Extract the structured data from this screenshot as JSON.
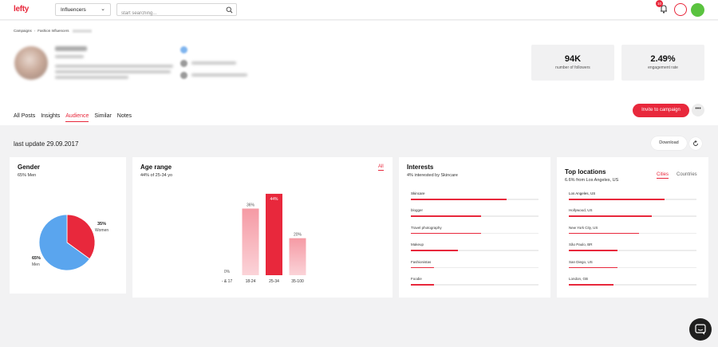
{
  "header": {
    "logo": "lefty",
    "category_select": "Influencers",
    "search_placeholder": "start searching...",
    "notification_count": "10"
  },
  "breadcrumb": [
    "Campaigns",
    "Fashion Influencers"
  ],
  "stats": [
    {
      "value": "94K",
      "label": "number of followers"
    },
    {
      "value": "2.49%",
      "label": "engagement rate"
    }
  ],
  "tabs": [
    "All Posts",
    "Insights",
    "Audience",
    "Similar",
    "Notes"
  ],
  "active_tab": "Audience",
  "invite_label": "Invite to campaign",
  "more_label": "•••",
  "last_update": "last update 29.09.2017",
  "download_label": "Download",
  "gender": {
    "title": "Gender",
    "subtitle": "65% Men",
    "women_pct": "35%",
    "women_label": "Women",
    "men_pct": "65%",
    "men_label": "Men"
  },
  "age": {
    "title": "Age range",
    "subtitle": "44% of 25-34 yo",
    "filter": "All"
  },
  "interests": {
    "title": "Interests",
    "subtitle": "4% interested by Skincare",
    "items": [
      {
        "label": "Skincare",
        "value": 0.75
      },
      {
        "label": "blogger",
        "value": 0.55
      },
      {
        "label": "Travel photography",
        "value": 0.55
      },
      {
        "label": "Makeup",
        "value": 0.37
      },
      {
        "label": "Fashionistas",
        "value": 0.18
      },
      {
        "label": "Foodie",
        "value": 0.18
      }
    ]
  },
  "locations": {
    "title": "Top locations",
    "subtitle": "6.6% from Los Angeles, US",
    "tab_cities": "Cities",
    "tab_countries": "Countries",
    "items": [
      {
        "label": "Los Angeles, US",
        "value": 0.75
      },
      {
        "label": "Hollywood, US",
        "value": 0.65
      },
      {
        "label": "New York City, US",
        "value": 0.55
      },
      {
        "label": "São Paulo, BR",
        "value": 0.38
      },
      {
        "label": "San Diego, US",
        "value": 0.38
      },
      {
        "label": "London, GB",
        "value": 0.35
      }
    ]
  },
  "colors": {
    "accent": "#e8283c",
    "pie_men": "#5aa5ee",
    "pie_women": "#e8283c",
    "bar_light": "#f7a9b1",
    "green": "#5ac33f"
  },
  "chart_data": [
    {
      "type": "pie",
      "title": "Gender",
      "categories": [
        "Women",
        "Men"
      ],
      "values": [
        35,
        65
      ]
    },
    {
      "type": "bar",
      "title": "Age range",
      "categories": [
        "- & 17",
        "18-24",
        "25-34",
        "35-100"
      ],
      "values": [
        0,
        36,
        44,
        20
      ],
      "value_labels": [
        "0%",
        "36%",
        "44%",
        "20%"
      ],
      "ylim": [
        0,
        50
      ],
      "grid": false
    }
  ]
}
